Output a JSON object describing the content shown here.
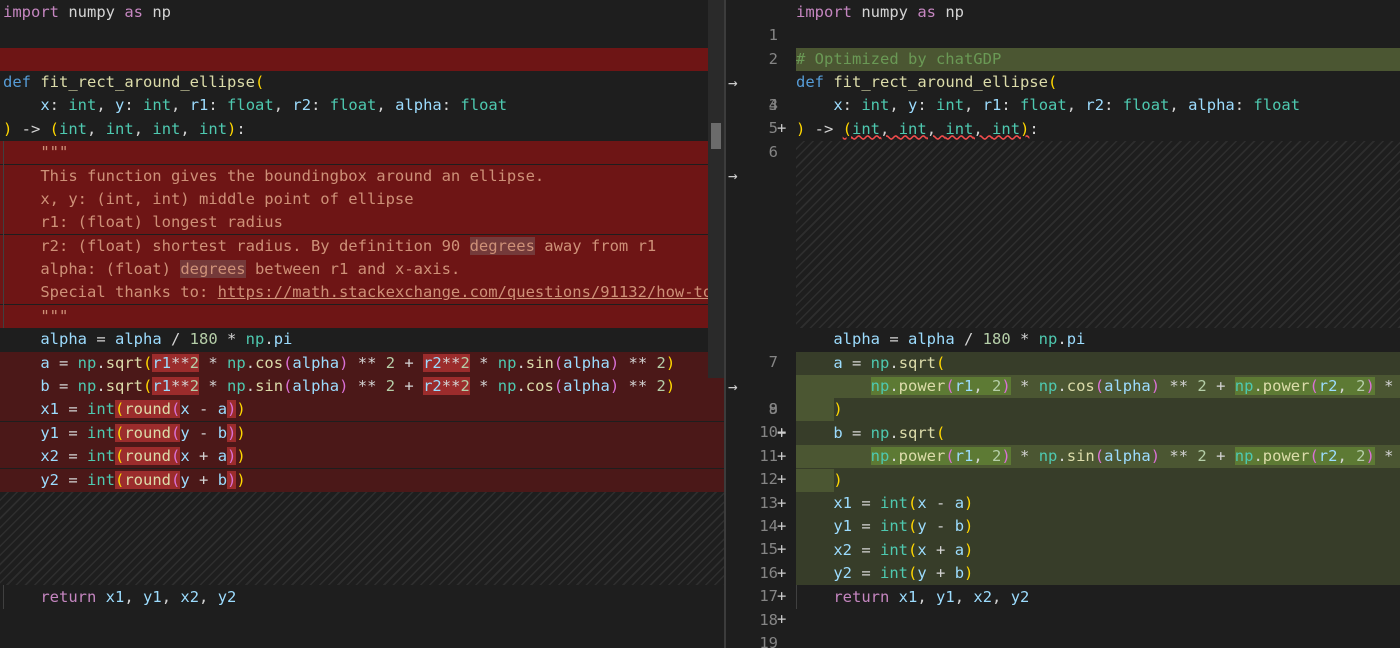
{
  "left": {
    "line1": [
      "import",
      " numpy ",
      "as",
      " np"
    ],
    "def_line": [
      "def",
      " ",
      "fit_rect_around_ellipse",
      "("
    ],
    "params": [
      "x",
      ": ",
      "int",
      ", ",
      "y",
      ": ",
      "int",
      ", ",
      "r1",
      ": ",
      "float",
      ", ",
      "r2",
      ": ",
      "float",
      ", ",
      "alpha",
      ": ",
      "float"
    ],
    "ret_line": [
      ")",
      " -> ",
      "(",
      "int",
      ", ",
      "int",
      ", ",
      "int",
      ", ",
      "int",
      ")",
      ":"
    ],
    "doc": [
      "\"\"\"",
      "This function gives the boundingbox around an ellipse.",
      "x, y: (int, int) middle point of ellipse",
      "r1: (float) longest radius",
      "r2: (float) shortest radius. By definition 90 ",
      "alpha: (float) ",
      "Special thanks to: ",
      "\"\"\""
    ],
    "doc_words": {
      "degrees": "degrees",
      "away": " away from r1",
      "between": " between r1 and x-axis.",
      "url": "https://math.stackexchange.com/questions/91132/how-to"
    },
    "alpha_line": [
      "alpha",
      " = ",
      "alpha",
      " / ",
      "180",
      " * ",
      "np",
      ".",
      "pi"
    ],
    "a_line": [
      "a",
      " = ",
      "np",
      ".",
      "sqrt",
      "(",
      "r1",
      "**",
      "2",
      " * ",
      "np",
      ".",
      "cos",
      "(",
      "alpha",
      ")",
      " ** ",
      "2",
      " + ",
      "r2",
      "**",
      "2",
      " * ",
      "np",
      ".",
      "sin",
      "(",
      "alpha",
      ")",
      " ** ",
      "2",
      ")"
    ],
    "b_line": [
      "b",
      " = ",
      "np",
      ".",
      "sqrt",
      "(",
      "r1",
      "**",
      "2",
      " * ",
      "np",
      ".",
      "sin",
      "(",
      "alpha",
      ")",
      " ** ",
      "2",
      " + ",
      "r2",
      "**",
      "2",
      " * ",
      "np",
      ".",
      "cos",
      "(",
      "alpha",
      ")",
      " ** ",
      "2",
      ")"
    ],
    "x1_line": [
      "x1",
      " = ",
      "int",
      "(",
      "round",
      "(",
      "x",
      " - ",
      "a",
      ")",
      ")"
    ],
    "y1_line": [
      "y1",
      " = ",
      "int",
      "(",
      "round",
      "(",
      "y",
      " - ",
      "b",
      ")",
      ")"
    ],
    "x2_line": [
      "x2",
      " = ",
      "int",
      "(",
      "round",
      "(",
      "x",
      " + ",
      "a",
      ")",
      ")"
    ],
    "y2_line": [
      "y2",
      " = ",
      "int",
      "(",
      "round",
      "(",
      "y",
      " + ",
      "b",
      ")",
      ")"
    ],
    "return_line": [
      "return",
      " ",
      "x1",
      ", ",
      "y1",
      ", ",
      "x2",
      ", ",
      "y2"
    ]
  },
  "right": {
    "line_numbers": [
      "1",
      "2",
      "3",
      "4",
      "5",
      "6",
      "7",
      "8",
      "9",
      "10",
      "11",
      "12",
      "13",
      "14",
      "15",
      "16",
      "17",
      "18",
      "19"
    ],
    "add_marker": "+",
    "arrow": "→",
    "comment": "# Optimized by chatGDP",
    "a_open": [
      "a",
      " = ",
      "np",
      ".",
      "sqrt",
      "("
    ],
    "a_inner": [
      "np",
      ".",
      "power",
      "(",
      "r1",
      ", ",
      "2",
      ")",
      " * ",
      "np",
      ".",
      "cos",
      "(",
      "alpha",
      ")",
      " ** ",
      "2",
      " + ",
      "np",
      ".",
      "power",
      "(",
      "r2",
      ", ",
      "2",
      ")",
      " *"
    ],
    "b_open": [
      "b",
      " = ",
      "np",
      ".",
      "sqrt",
      "("
    ],
    "b_inner": [
      "np",
      ".",
      "power",
      "(",
      "r1",
      ", ",
      "2",
      ")",
      " * ",
      "np",
      ".",
      "sin",
      "(",
      "alpha",
      ")",
      " ** ",
      "2",
      " + ",
      "np",
      ".",
      "power",
      "(",
      "r2",
      ", ",
      "2",
      ")",
      " *"
    ],
    "close": ")",
    "x1_line": [
      "x1",
      " = ",
      "int",
      "(",
      "x",
      " - ",
      "a",
      ")"
    ],
    "y1_line": [
      "y1",
      " = ",
      "int",
      "(",
      "y",
      " - ",
      "b",
      ")"
    ],
    "x2_line": [
      "x2",
      " = ",
      "int",
      "(",
      "x",
      " + ",
      "a",
      ")"
    ],
    "y2_line": [
      "y2",
      " = ",
      "int",
      "(",
      "y",
      " + ",
      "b",
      ")"
    ]
  },
  "colors": {
    "deleted_line": "#4b1818",
    "deleted_strong": "#6e1515",
    "inserted_line": "#373d29",
    "inserted_strong": "#4b5632"
  }
}
